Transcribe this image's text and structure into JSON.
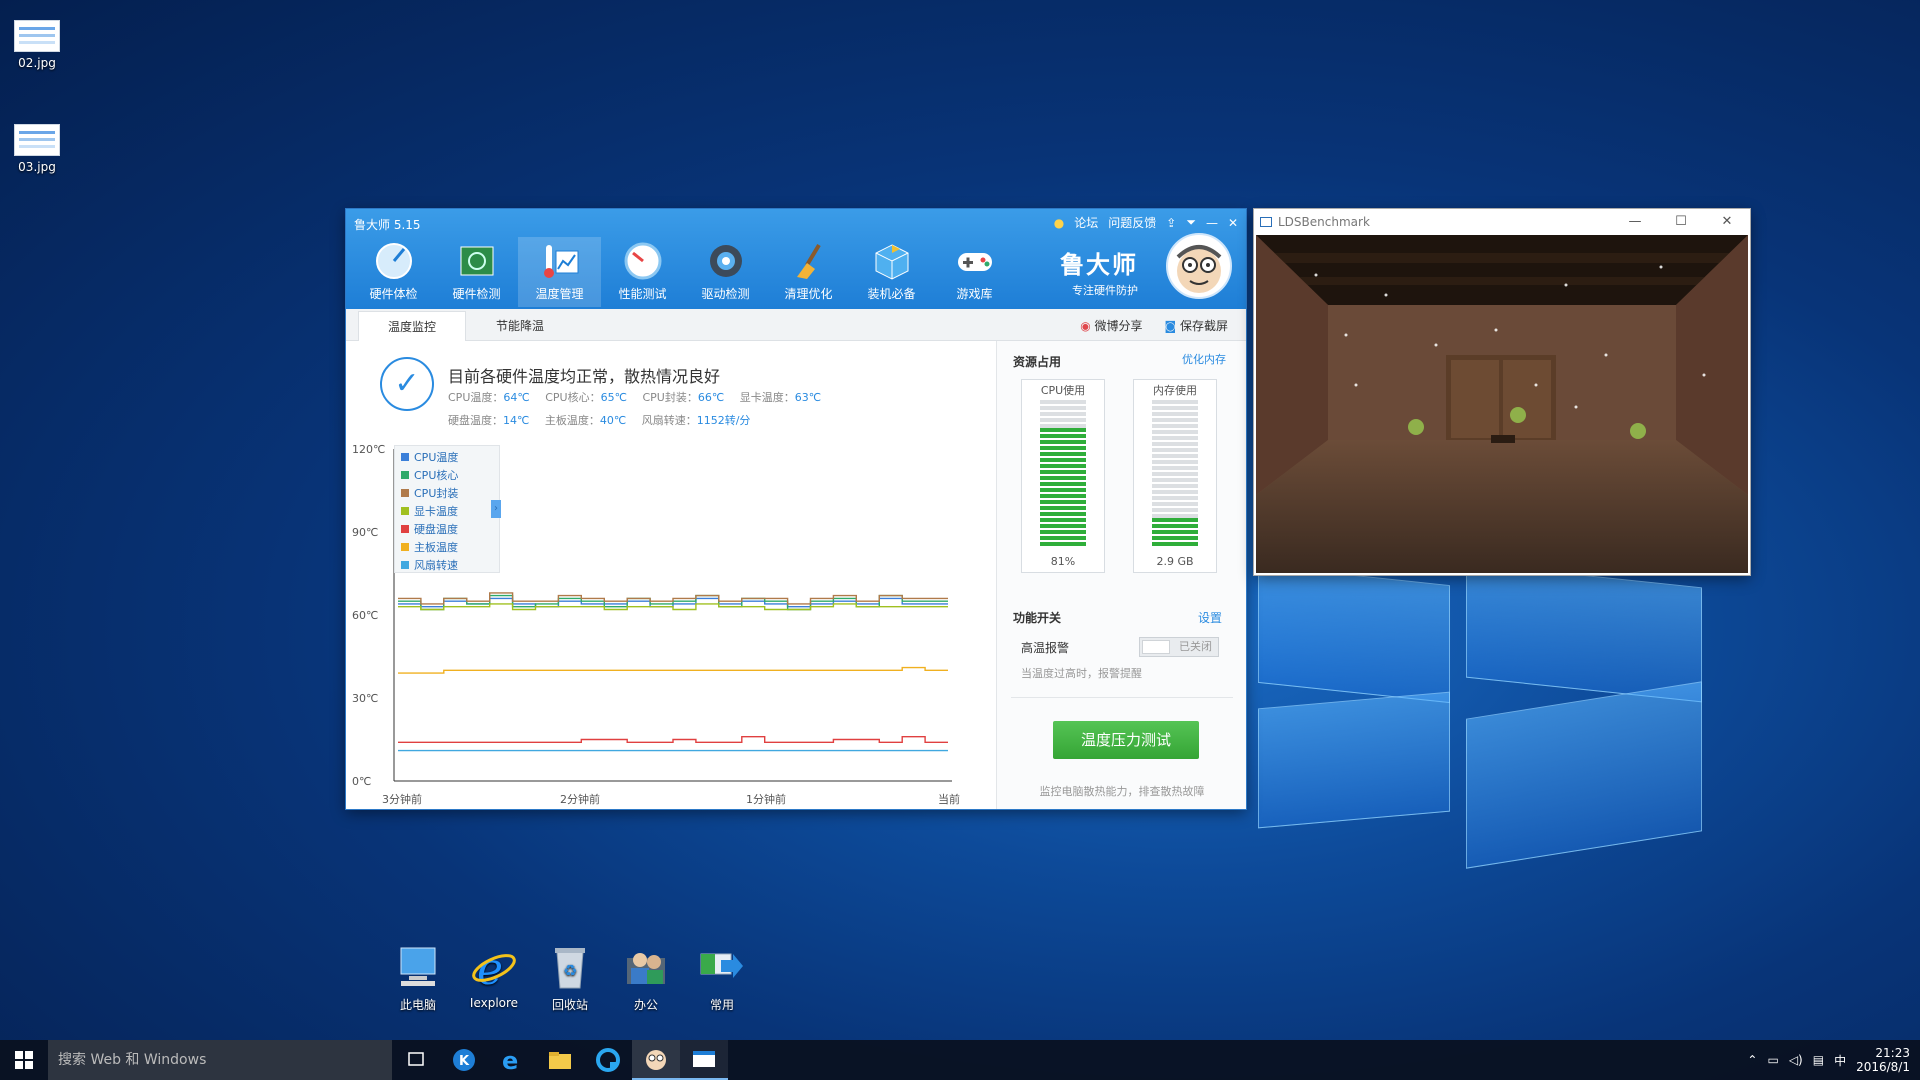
{
  "desktop": {
    "top_icons": [
      {
        "label": "02.jpg"
      },
      {
        "label": "03.jpg"
      }
    ],
    "bottom_icons": [
      {
        "label": "此电脑"
      },
      {
        "label": "Iexplore"
      },
      {
        "label": "回收站"
      },
      {
        "label": "办公"
      },
      {
        "label": "常用"
      }
    ]
  },
  "master": {
    "title": "鲁大师 5.15",
    "top_links": [
      "论坛",
      "问题反馈"
    ],
    "nav": [
      {
        "label": "硬件体检",
        "icon": "health-check-icon"
      },
      {
        "label": "硬件检测",
        "icon": "hardware-board-icon"
      },
      {
        "label": "温度管理",
        "icon": "thermometer-icon"
      },
      {
        "label": "性能测试",
        "icon": "speedometer-icon"
      },
      {
        "label": "驱动检测",
        "icon": "gear-icon"
      },
      {
        "label": "清理优化",
        "icon": "broom-icon"
      },
      {
        "label": "装机必备",
        "icon": "package-box-icon"
      },
      {
        "label": "游戏库",
        "icon": "gamepad-icon"
      }
    ],
    "active_nav": 2,
    "brand_title": "鲁大师",
    "brand_sub": "专注硬件防护",
    "sub_tabs": [
      "温度监控",
      "节能降温"
    ],
    "share_label": "微博分享",
    "screenshot_label": "保存截屏",
    "status": {
      "main": "目前各硬件温度均正常，散热情况良好",
      "line1": [
        {
          "label": "CPU温度：",
          "value": "64℃"
        },
        {
          "label": "CPU核心：",
          "value": "65℃"
        },
        {
          "label": "CPU封装：",
          "value": "66℃"
        },
        {
          "label": "显卡温度：",
          "value": "63℃"
        }
      ],
      "line2": [
        {
          "label": "硬盘温度：",
          "value": "14℃"
        },
        {
          "label": "主板温度：",
          "value": "40℃"
        },
        {
          "label": "风扇转速：",
          "value": "1152转/分"
        }
      ]
    },
    "legend": [
      {
        "name": "CPU温度",
        "color": "#3b7fd9"
      },
      {
        "name": "CPU核心",
        "color": "#2faa6a"
      },
      {
        "name": "CPU封装",
        "color": "#b07a4a"
      },
      {
        "name": "显卡温度",
        "color": "#a0c020"
      },
      {
        "name": "硬盘温度",
        "color": "#e04040"
      },
      {
        "name": "主板温度",
        "color": "#f0b020"
      },
      {
        "name": "风扇转速",
        "color": "#40a8e0"
      }
    ],
    "resources": {
      "title": "资源占用",
      "optimize": "优化内存",
      "cpu_label": "CPU使用",
      "cpu_value": "81%",
      "cpu_fraction": 0.81,
      "mem_label": "内存使用",
      "mem_value": "2.9 GB",
      "mem_fraction": 0.2
    },
    "features": {
      "title": "功能开关",
      "settings": "设置",
      "alarm_label": "高温报警",
      "alarm_state": "已关闭",
      "alarm_desc": "当温度过高时，报警提醒"
    },
    "stress_button": "温度压力测试",
    "stress_desc": "监控电脑散热能力，排查散热故障"
  },
  "chart_data": {
    "type": "line",
    "x_labels": [
      "3分钟前",
      "2分钟前",
      "1分钟前",
      "当前"
    ],
    "y_labels": [
      "0℃",
      "30℃",
      "60℃",
      "90℃",
      "120℃"
    ],
    "ylim": [
      0,
      120
    ],
    "series": [
      {
        "name": "CPU温度",
        "color": "#3b7fd9",
        "values": [
          64,
          63,
          65,
          64,
          66,
          64,
          63,
          65,
          64,
          64,
          65,
          63,
          64,
          66,
          64,
          65,
          64,
          63,
          64,
          65,
          64,
          66,
          64,
          64
        ]
      },
      {
        "name": "CPU核心",
        "color": "#2faa6a",
        "values": [
          65,
          62,
          66,
          64,
          67,
          63,
          64,
          66,
          65,
          63,
          66,
          64,
          65,
          67,
          63,
          66,
          65,
          62,
          65,
          66,
          63,
          67,
          65,
          65
        ]
      },
      {
        "name": "CPU封装",
        "color": "#b07a4a",
        "values": [
          66,
          64,
          66,
          65,
          68,
          65,
          65,
          67,
          66,
          65,
          66,
          65,
          66,
          67,
          65,
          66,
          66,
          64,
          66,
          67,
          65,
          67,
          66,
          66
        ]
      },
      {
        "name": "显卡温度",
        "color": "#a0c020",
        "values": [
          63,
          62,
          63,
          63,
          64,
          62,
          63,
          63,
          63,
          62,
          63,
          63,
          62,
          64,
          63,
          63,
          62,
          62,
          63,
          64,
          63,
          63,
          63,
          63
        ]
      },
      {
        "name": "硬盘温度",
        "color": "#e04040",
        "values": [
          14,
          14,
          14,
          14,
          14,
          14,
          14,
          14,
          15,
          15,
          14,
          14,
          15,
          14,
          14,
          16,
          14,
          14,
          14,
          15,
          15,
          14,
          16,
          14
        ]
      },
      {
        "name": "主板温度",
        "color": "#f0b020",
        "values": [
          39,
          39,
          40,
          40,
          40,
          40,
          40,
          40,
          40,
          40,
          40,
          40,
          40,
          40,
          40,
          40,
          40,
          40,
          40,
          40,
          40,
          40,
          41,
          40
        ]
      },
      {
        "name": "风扇转速",
        "color": "#40a8e0",
        "values": [
          11,
          11,
          11,
          11,
          11,
          11,
          11,
          11,
          11,
          11,
          11,
          11,
          11,
          11,
          11,
          11,
          11,
          11,
          11,
          11,
          11,
          11,
          11,
          11
        ]
      }
    ]
  },
  "bench": {
    "title": "LDSBenchmark",
    "min": "—",
    "max": "☐",
    "close": "✕"
  },
  "taskbar": {
    "search_placeholder": "搜索 Web 和 Windows",
    "time": "21:23",
    "date": "2016/8/1",
    "ime": "中"
  }
}
